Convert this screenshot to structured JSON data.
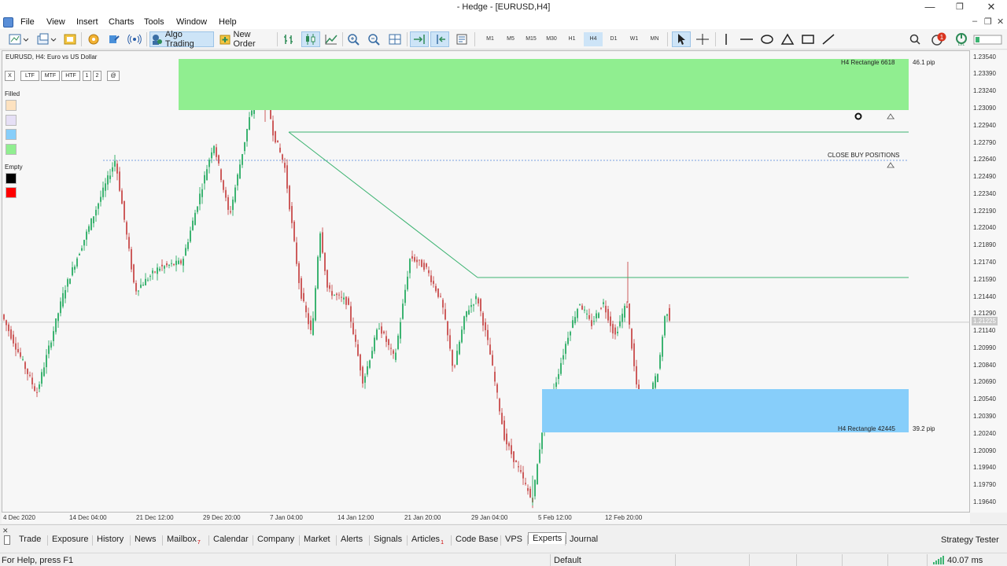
{
  "window": {
    "title": "- Hedge - [EURUSD,H4]"
  },
  "menu": [
    "File",
    "View",
    "Insert",
    "Charts",
    "Tools",
    "Window",
    "Help"
  ],
  "toolbar": {
    "algo_trading": "Algo Trading",
    "new_order": "New Order",
    "timeframes": [
      "M1",
      "M5",
      "M15",
      "M30",
      "H1",
      "H4",
      "D1",
      "W1",
      "MN"
    ],
    "active_timeframe": "H4",
    "notifications": "1"
  },
  "chart": {
    "symbol_label": "EURUSD, H4:  Euro vs US Dollar",
    "panel_buttons": [
      "X",
      "LTF",
      "MTF",
      "HTF",
      "1",
      "2",
      "@"
    ],
    "filled_label": "Filled",
    "empty_label": "Empty",
    "filled_colors": [
      "#fde2c0",
      "#e6e0f6",
      "#87cefa",
      "#90ee90"
    ],
    "empty_colors": [
      "#000000",
      "#ff0000"
    ],
    "rect_top": {
      "label": "H4 Rectangle 6618",
      "pip": "46.1 pip",
      "color": "#90ee90"
    },
    "rect_bottom": {
      "label": "H4 Rectangle 42445",
      "pip": "39.2 pip",
      "color": "#87cefa"
    },
    "close_label": "CLOSE BUY POSITIONS",
    "current_price": "1.21225",
    "price_labels": [
      "1.23540",
      "1.23390",
      "1.23240",
      "1.23090",
      "1.22940",
      "1.22790",
      "1.22640",
      "1.22490",
      "1.22340",
      "1.22190",
      "1.22040",
      "1.21890",
      "1.21740",
      "1.21590",
      "1.21440",
      "1.21290",
      "1.21140",
      "1.20990",
      "1.20840",
      "1.20690",
      "1.20540",
      "1.20390",
      "1.20240",
      "1.20090",
      "1.19940",
      "1.19790",
      "1.19640"
    ],
    "time_labels": [
      "4 Dec 2020",
      "14 Dec 04:00",
      "21 Dec 12:00",
      "29 Dec 20:00",
      "7 Jan 04:00",
      "14 Jan 12:00",
      "21 Jan 20:00",
      "29 Jan 04:00",
      "5 Feb 12:00",
      "12 Feb 20:00"
    ],
    "price_scale": {
      "max": 1.236,
      "min": 1.1955
    },
    "bull_color": "#3cb371",
    "bear_color": "#cd5c5c"
  },
  "bottom_tabs": [
    {
      "label": "Trade",
      "badge": ""
    },
    {
      "label": "Exposure",
      "badge": ""
    },
    {
      "label": "History",
      "badge": ""
    },
    {
      "label": "News",
      "badge": ""
    },
    {
      "label": "Mailbox",
      "badge": "7"
    },
    {
      "label": "Calendar",
      "badge": ""
    },
    {
      "label": "Company",
      "badge": ""
    },
    {
      "label": "Market",
      "badge": ""
    },
    {
      "label": "Alerts",
      "badge": ""
    },
    {
      "label": "Signals",
      "badge": ""
    },
    {
      "label": "Articles",
      "badge": "1"
    },
    {
      "label": "Code Base",
      "badge": ""
    },
    {
      "label": "VPS",
      "badge": ""
    },
    {
      "label": "Experts",
      "badge": ""
    },
    {
      "label": "Journal",
      "badge": ""
    }
  ],
  "active_tab": "Experts",
  "strategy_tester": "Strategy Tester",
  "status": {
    "help": "For Help, press F1",
    "profile": "Default",
    "ping": "40.07 ms"
  }
}
